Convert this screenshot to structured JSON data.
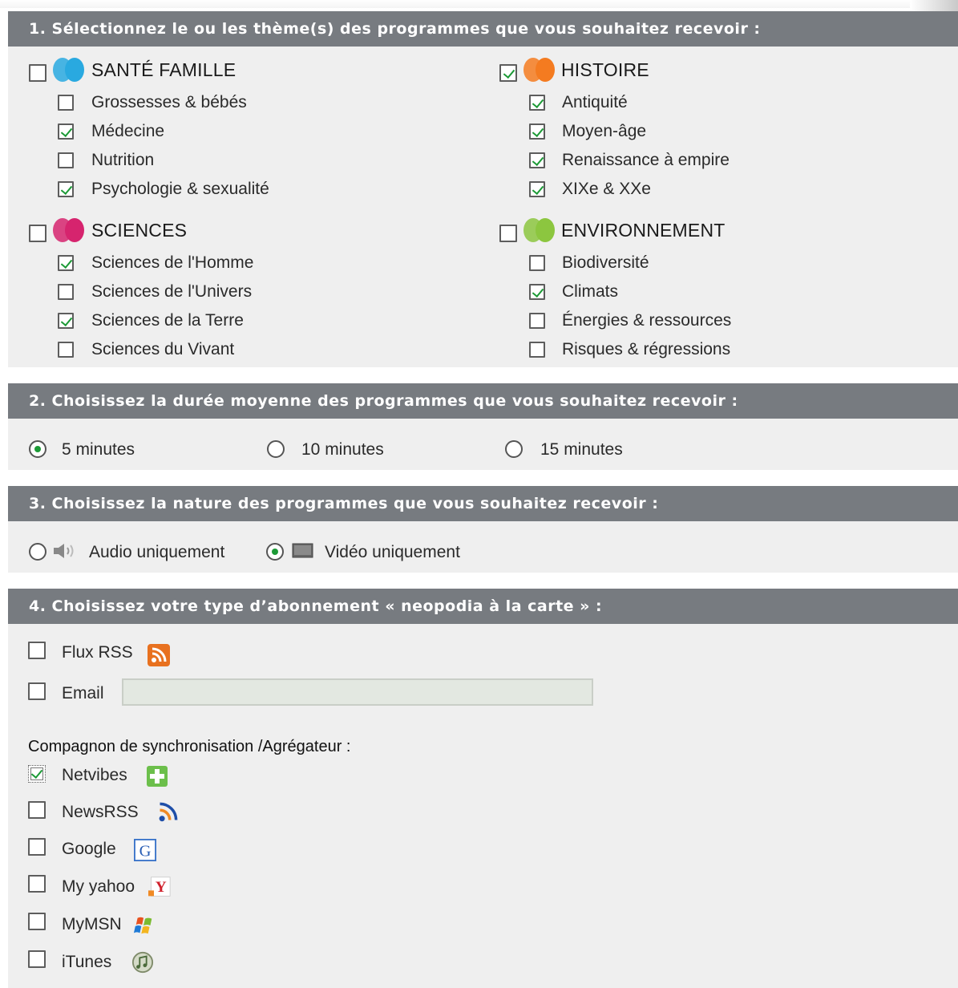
{
  "section1": {
    "title": "1. Sélectionnez le ou les thème(s) des programmes que vous souhaitez recevoir :",
    "categories": [
      {
        "name": "SANTÉ FAMILLE",
        "checked": false,
        "color": "#29a9e0",
        "items": [
          {
            "label": "Grossesses & bébés",
            "checked": false
          },
          {
            "label": "Médecine",
            "checked": true
          },
          {
            "label": "Nutrition",
            "checked": false
          },
          {
            "label": "Psychologie & sexualité",
            "checked": true
          }
        ]
      },
      {
        "name": "HISTOIRE",
        "checked": true,
        "color": "#f47b20",
        "items": [
          {
            "label": "Antiquité",
            "checked": true
          },
          {
            "label": "Moyen-âge",
            "checked": true
          },
          {
            "label": "Renaissance à empire",
            "checked": true
          },
          {
            "label": "XIXe & XXe",
            "checked": true
          }
        ]
      },
      {
        "name": "SCIENCES",
        "checked": false,
        "color": "#d6246e",
        "items": [
          {
            "label": "Sciences de l'Homme",
            "checked": true
          },
          {
            "label": "Sciences de l'Univers",
            "checked": false
          },
          {
            "label": "Sciences de la Terre",
            "checked": true
          },
          {
            "label": "Sciences du Vivant",
            "checked": false
          }
        ]
      },
      {
        "name": "ENVIRONNEMENT",
        "checked": false,
        "color": "#8cc63f",
        "items": [
          {
            "label": "Biodiversité",
            "checked": false
          },
          {
            "label": "Climats",
            "checked": true
          },
          {
            "label": "Énergies & ressources",
            "checked": false
          },
          {
            "label": "Risques & régressions",
            "checked": false
          }
        ]
      }
    ]
  },
  "section2": {
    "title": "2. Choisissez la durée moyenne des programmes que vous souhaitez recevoir :",
    "options": [
      {
        "label": "5 minutes",
        "selected": true
      },
      {
        "label": "10 minutes",
        "selected": false
      },
      {
        "label": "15 minutes",
        "selected": false
      }
    ]
  },
  "section3": {
    "title": "3. Choisissez la nature des programmes que vous souhaitez recevoir :",
    "options": [
      {
        "label": "Audio uniquement",
        "selected": false,
        "icon": "speaker-icon"
      },
      {
        "label": "Vidéo uniquement",
        "selected": true,
        "icon": "screen-icon"
      }
    ]
  },
  "section4": {
    "title": "4. Choisissez votre type d’abonnement « neopodia à la carte » :",
    "rss": {
      "label": "Flux RSS",
      "checked": false,
      "icon": "rss-icon"
    },
    "email": {
      "label": "Email",
      "checked": false,
      "value": "",
      "placeholder": ""
    },
    "aggregator_title": "Compagnon de synchronisation /Agrégateur :",
    "aggregators": [
      {
        "label": "Netvibes",
        "checked": true,
        "icon": "netvibes-icon"
      },
      {
        "label": "NewsRSS",
        "checked": false,
        "icon": "newsrss-icon"
      },
      {
        "label": "Google",
        "checked": false,
        "icon": "google-icon"
      },
      {
        "label": "My yahoo",
        "checked": false,
        "icon": "yahoo-icon"
      },
      {
        "label": "MyMSN",
        "checked": false,
        "icon": "msn-icon"
      },
      {
        "label": "iTunes",
        "checked": false,
        "icon": "itunes-icon"
      }
    ]
  }
}
